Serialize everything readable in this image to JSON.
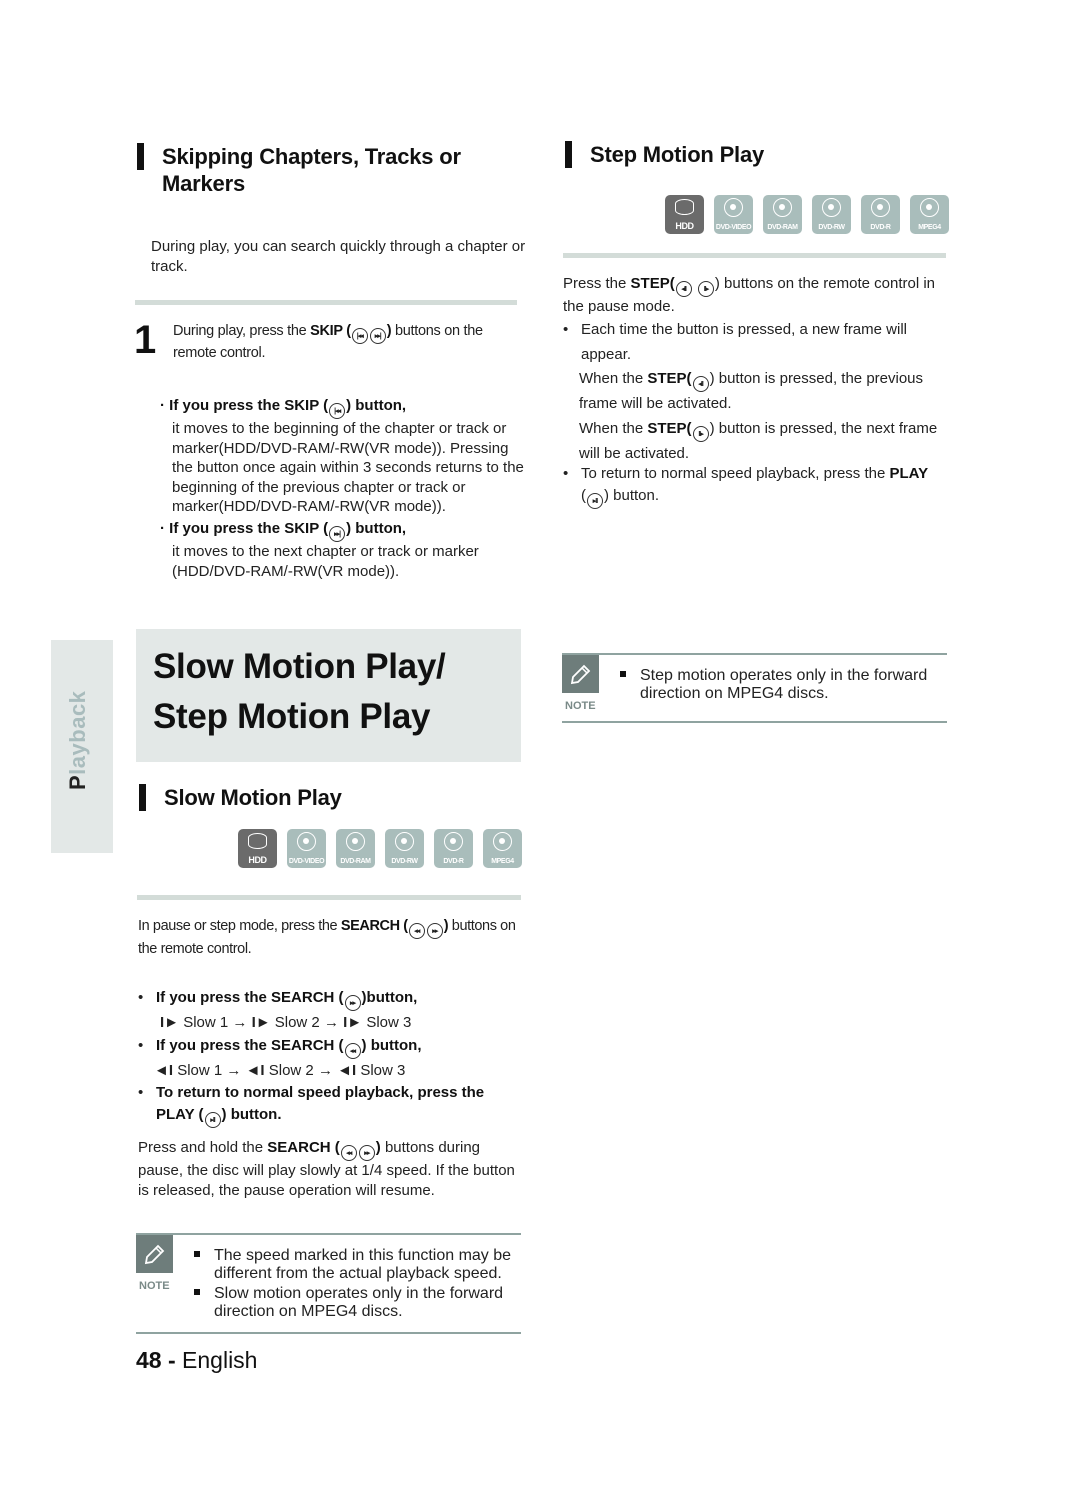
{
  "side_tab": {
    "first_letter": "P",
    "rest": "layback"
  },
  "skip_section": {
    "title_line1": "Skipping Chapters, Tracks or",
    "title_line2": "Markers",
    "intro": "During play, you can search quickly through a chapter or track.",
    "step_number": "1",
    "step_text_pre": "During play, press the ",
    "step_text_bold": "SKIP (",
    "step_text_close": ")",
    "step_text_post": " buttons on the remote control.",
    "bullets": [
      {
        "heading_pre": "If you press the SKIP (",
        "heading_post": ") button,",
        "icon": "skip-back",
        "body": "it moves to the beginning of the chapter or track or marker(HDD/DVD-RAM/-RW(VR mode)). Pressing the button once again within 3 seconds returns to the beginning of the previous chapter or track or marker(HDD/DVD-RAM/-RW(VR mode))."
      },
      {
        "heading_pre": "If you press the SKIP (",
        "heading_post": ") button,",
        "icon": "skip-forward",
        "body": "it moves to the next chapter or track or marker (HDD/DVD-RAM/-RW(VR mode))."
      }
    ]
  },
  "chapter_banner": {
    "line1": "Slow Motion Play/",
    "line2": "Step Motion Play"
  },
  "disc_types": [
    "HDD",
    "DVD-VIDEO",
    "DVD-RAM",
    "DVD-RW",
    "DVD-R",
    "MPEG4"
  ],
  "slow_section": {
    "title": "Slow Motion Play",
    "intro_pre": "In pause or step mode, press the ",
    "intro_bold": "SEARCH (",
    "intro_close": ")",
    "intro_post": " buttons on the remote control.",
    "bullets": [
      {
        "heading_pre": "If you press the SEARCH (",
        "heading_post": ")button,",
        "seq": [
          "Slow 1",
          "Slow 2",
          "Slow 3"
        ],
        "seq_icon": "I►"
      },
      {
        "heading_pre": "If you press the SEARCH (",
        "heading_post": ") button,",
        "seq": [
          "Slow 1",
          "Slow 2",
          "Slow 3"
        ],
        "seq_icon": "◄I"
      },
      {
        "heading_line1": "To return to normal speed playback, press the",
        "heading_line2_pre": "PLAY (",
        "heading_line2_post": ") button."
      }
    ],
    "hold_pre": "Press and hold the ",
    "hold_bold": "SEARCH (",
    "hold_close": ")",
    "hold_post": " buttons during pause, the disc will play slowly at 1/4 speed. If the button is released, the pause operation will resume.",
    "note_label": "NOTE",
    "notes": [
      "The speed marked in this function may be different from the actual playback speed.",
      "Slow motion operates only in the forward direction on MPEG4 discs."
    ]
  },
  "step_section": {
    "title": "Step Motion Play",
    "intro_pre": "Press the ",
    "intro_bold": "STEP(",
    "intro_post": ") buttons on the remote control in the pause mode.",
    "bullet1_line": "Each time the button is pressed, a new frame will appear.",
    "prev_pre": "When the ",
    "prev_bold": "STEP(",
    "prev_post": ") button is pressed, the previous frame will be activated.",
    "next_pre": "When the ",
    "next_bold": "STEP(",
    "next_post": ") button is pressed, the next frame will be activated.",
    "bullet2_pre": "To return to normal speed playback, press the ",
    "bullet2_bold": "PLAY",
    "bullet2_post": ") button.",
    "note_label": "NOTE",
    "notes": [
      "Step motion operates only in the forward direction on MPEG4 discs."
    ]
  },
  "footer": {
    "page_number": "48 -",
    "language": "English"
  }
}
